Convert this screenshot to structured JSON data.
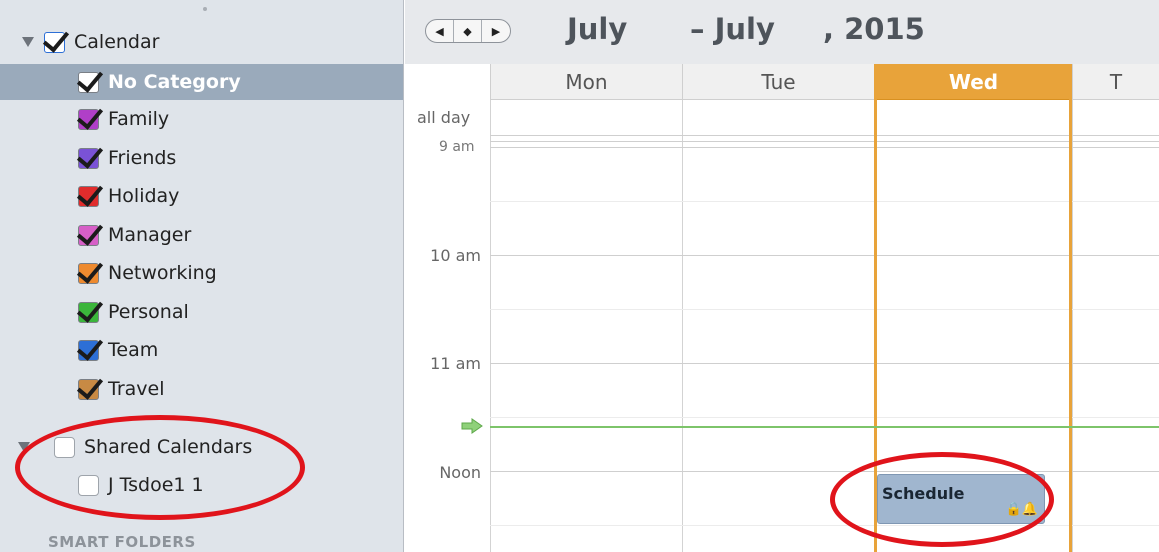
{
  "sidebar": {
    "calendar_group": {
      "label": "Calendar",
      "checked": true
    },
    "categories": [
      {
        "label": "No Category",
        "color": "#ffffff",
        "checked": true,
        "selected": true
      },
      {
        "label": "Family",
        "color": "#b03fc8",
        "checked": true
      },
      {
        "label": "Friends",
        "color": "#7a52d6",
        "checked": true
      },
      {
        "label": "Holiday",
        "color": "#e02c2c",
        "checked": true
      },
      {
        "label": "Manager",
        "color": "#d65fc7",
        "checked": true
      },
      {
        "label": "Networking",
        "color": "#ee8a2f",
        "checked": true
      },
      {
        "label": "Personal",
        "color": "#3bb53b",
        "checked": true
      },
      {
        "label": "Team",
        "color": "#2d6fd6",
        "checked": true
      },
      {
        "label": "Travel",
        "color": "#c88a44",
        "checked": true
      }
    ],
    "shared_group": {
      "label": "Shared Calendars",
      "checked": false
    },
    "shared_items": [
      {
        "label": "J Tsdoe1 1",
        "checked": false
      }
    ],
    "smart_folders_label": "SMART FOLDERS"
  },
  "calendar": {
    "title_start": "July",
    "title_sep": "– July",
    "title_year": ", 2015",
    "days": [
      "Mon",
      "Tue",
      "Wed",
      "T"
    ],
    "today": "Wed",
    "all_day_label": "all day",
    "cutoff_label": "9 am",
    "hours": [
      "10 am",
      "11 am",
      "Noon"
    ],
    "event": {
      "title": "Schedule",
      "icons": "🔒🔔"
    },
    "colors": {
      "today": "#e8a33a",
      "now_line": "#7dc46a",
      "event": "#a0b6cf",
      "annotation": "#e0141b"
    }
  }
}
